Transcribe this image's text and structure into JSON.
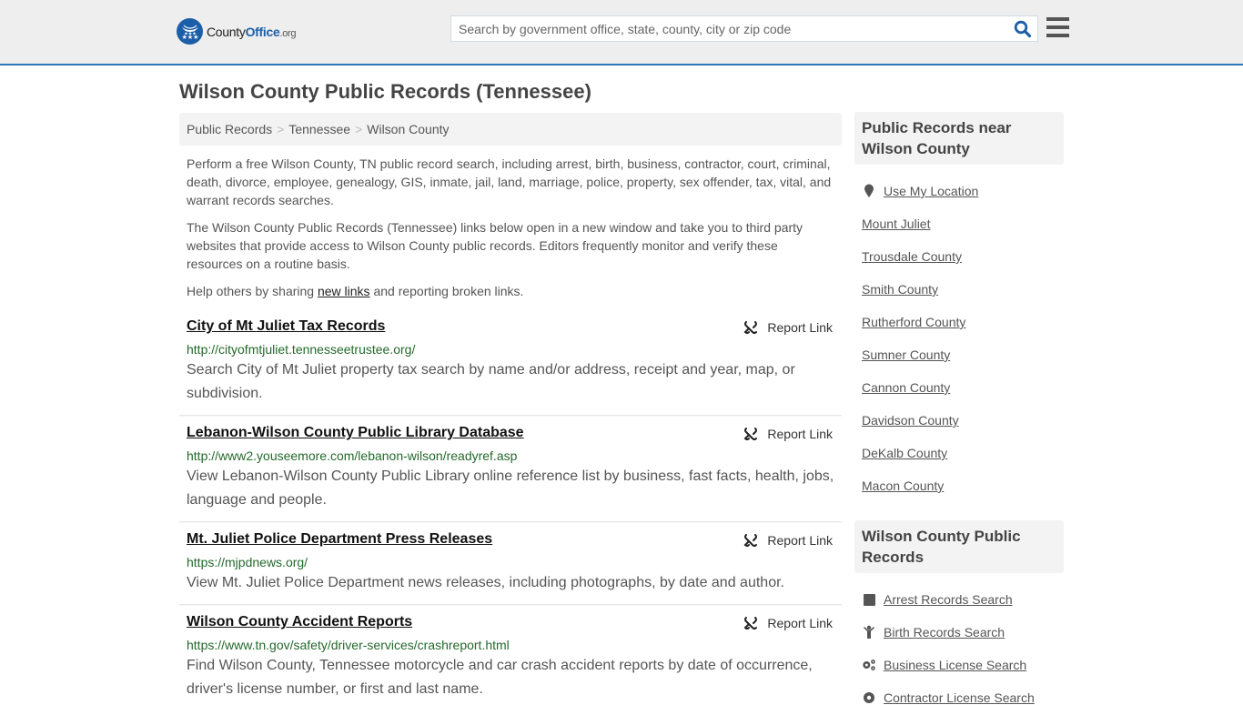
{
  "header": {
    "logo": {
      "name_prefix": "County",
      "name_brand": "Office",
      "name_suffix": ".org"
    },
    "search": {
      "placeholder": "Search by government office, state, county, city or zip code",
      "value": ""
    },
    "colors": {
      "brand": "#1c5fa8",
      "header_border": "#2e77b4"
    }
  },
  "page": {
    "title": "Wilson County Public Records (Tennessee)",
    "breadcrumb": [
      {
        "label": "Public Records"
      },
      {
        "label": "Tennessee"
      },
      {
        "label": "Wilson County"
      }
    ],
    "breadcrumb_separator": ">",
    "intro": {
      "p1": "Perform a free Wilson County, TN public record search, including arrest, birth, business, contractor, court, criminal, death, divorce, employee, genealogy, GIS, inmate, jail, land, marriage, police, property, sex offender, tax, vital, and warrant records searches.",
      "p2": "The Wilson County Public Records (Tennessee) links below open in a new window and take you to third party websites that provide access to Wilson County public records. Editors frequently monitor and verify these resources on a routine basis.",
      "p3_before": "Help others by sharing ",
      "p3_link": "new links",
      "p3_after": " and reporting broken links."
    }
  },
  "listings": [
    {
      "title": "City of Mt Juliet Tax Records",
      "url": "http://cityofmtjuliet.tennesseetrustee.org/",
      "description": "Search City of Mt Juliet property tax search by name and/or address, receipt and year, map, or subdivision.",
      "report_label": "Report Link"
    },
    {
      "title": "Lebanon-Wilson County Public Library Database",
      "url": "http://www2.youseemore.com/lebanon-wilson/readyref.asp",
      "description": "View Lebanon-Wilson County Public Library online reference list by business, fast facts, health, jobs, language and people.",
      "report_label": "Report Link"
    },
    {
      "title": "Mt. Juliet Police Department Press Releases",
      "url": "https://mjpdnews.org/",
      "description": "View Mt. Juliet Police Department news releases, including photographs, by date and author.",
      "report_label": "Report Link"
    },
    {
      "title": "Wilson County Accident Reports",
      "url": "https://www.tn.gov/safety/driver-services/crashreport.html",
      "description": "Find Wilson County, Tennessee motorcycle and car crash accident reports by date of occurrence, driver's license number, or first and last name.",
      "report_label": "Report Link"
    }
  ],
  "sidebar": {
    "nearby": {
      "heading": "Public Records near Wilson County",
      "use_location": {
        "label": "Use My Location",
        "icon": "map-marker-icon"
      },
      "links": [
        "Mount Juliet",
        "Trousdale County",
        "Smith County",
        "Rutherford County",
        "Sumner County",
        "Cannon County",
        "Davidson County",
        "DeKalb County",
        "Macon County"
      ]
    },
    "records": {
      "heading": "Wilson County Public Records",
      "links": [
        {
          "label": "Arrest Records Search",
          "icon": "square-icon"
        },
        {
          "label": "Birth Records Search",
          "icon": "child-icon"
        },
        {
          "label": "Business License Search",
          "icon": "gears-icon"
        },
        {
          "label": "Contractor License Search",
          "icon": "gear-icon"
        }
      ]
    }
  }
}
